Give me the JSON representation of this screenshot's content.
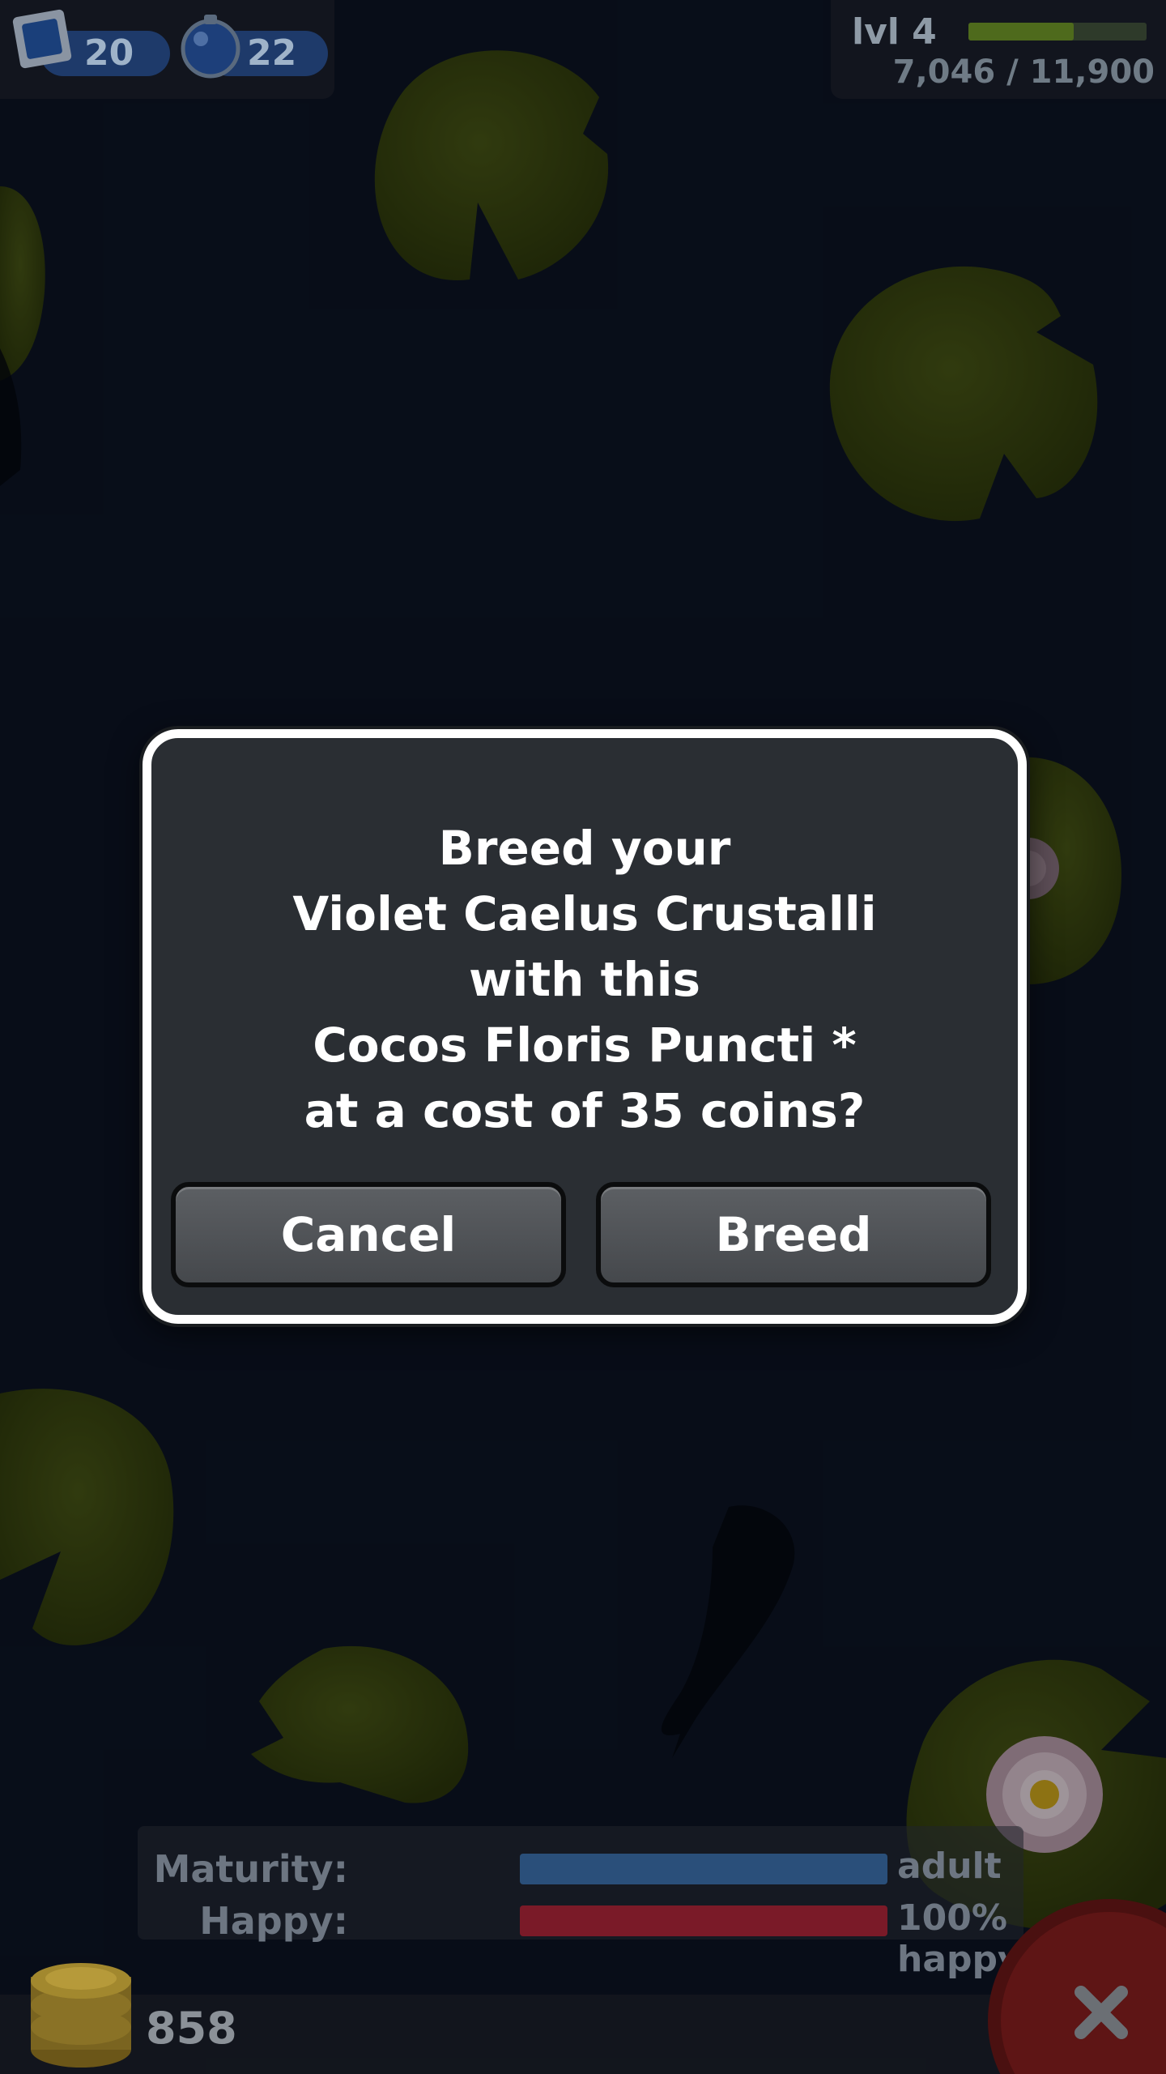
{
  "hud": {
    "stamps": "20",
    "gems": "22",
    "level_label": "lvl 4",
    "xp_text": "7,046 / 11,900",
    "xp_progress": 0.59
  },
  "dialog": {
    "lines": [
      "Breed your",
      "Violet Caelus Crustalli",
      "with this",
      "Cocos Floris Puncti *",
      "at a cost of 35 coins?"
    ],
    "cancel_label": "Cancel",
    "breed_label": "Breed"
  },
  "stats": {
    "maturity_label": "Maturity:",
    "maturity_value": "adult",
    "happy_label": "Happy:",
    "happy_value": "100% happy"
  },
  "coins": "858",
  "colors": {
    "water": "#0b1220",
    "lily_pad": "#3d4a12",
    "maturity_bar": "#2a4f7a",
    "happy_bar": "#7a1a28",
    "close_button": "#5a1414"
  },
  "icons": [
    "stamp-icon",
    "orb-icon",
    "coins-icon",
    "close-icon",
    "lotus-flower-icon"
  ]
}
